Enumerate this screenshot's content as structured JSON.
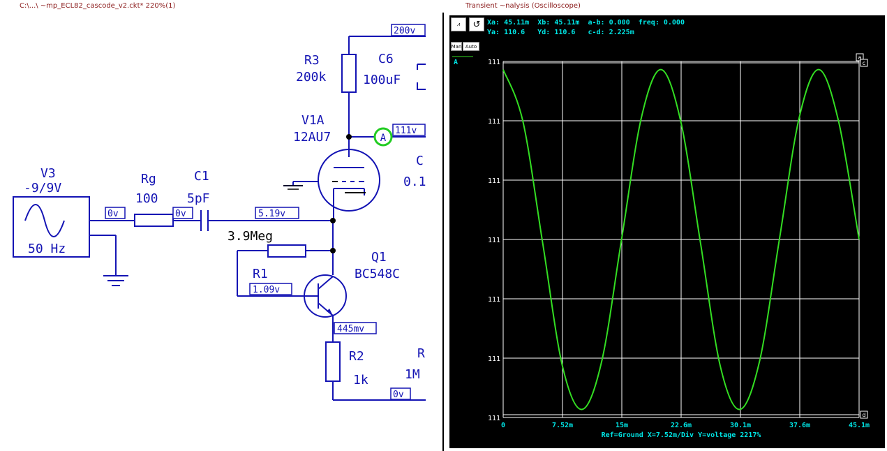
{
  "schematic_title": "C:\\...\\ ~mp_ECL82_cascode_v2.ckt* 220%(1)",
  "scope_title": "Transient ~nalysis (Oscilloscope)",
  "components": {
    "v3_name": "V3",
    "v3_value": "-9/9V",
    "v3_freq": "50 Hz",
    "rg_name": "Rg",
    "rg_value": "100",
    "c1_name": "C1",
    "c1_value": "5pF",
    "r3_name": "R3",
    "r3_value": "200k",
    "c6_name": "C6",
    "c6_value": "100uF",
    "v1a_name": "V1A",
    "v1a_value": "12AU7",
    "c_partial": "C",
    "c_partial_value": "0.1",
    "rbias_value": "3.9Meg",
    "r1_name": "R1",
    "q1_name": "Q1",
    "q1_value": "BC548C",
    "r2_name": "R2",
    "r2_value": "1k",
    "r_partial": "R",
    "r_partial_value": "1M"
  },
  "node_labels": {
    "supply": "200v",
    "plate": "111v",
    "grid": "5.19v",
    "source_out": "0v",
    "rg_out": "0v",
    "base": "1.09v",
    "emitter": "445mv",
    "bottom": "0v"
  },
  "probe_label": "A",
  "scope": {
    "readout_line1": "Xa: 45.11m  Xb: 45.11m  a-b: 0.000  freq: 0.000",
    "readout_line2": "Ya: 110.6   Yd: 110.6   c-d: 2.225m",
    "toolbar": {
      "man": "Man",
      "auto": "Auto"
    },
    "trace_label": "A",
    "cursor_labels": [
      "a",
      "c",
      "d"
    ],
    "y_ticks": [
      "111",
      "111",
      "111",
      "111",
      "111",
      "111",
      "111"
    ],
    "x_ticks": [
      "0",
      "7.52m",
      "15m",
      "22.6m",
      "30.1m",
      "37.6m",
      "45.1m"
    ],
    "footer": "Ref=Ground  X=7.52m/Div Y=voltage 2217%",
    "colors": {
      "trace": "#33dd22",
      "text": "#00e5e5",
      "grid": "#ffffff",
      "background": "#000000"
    }
  },
  "chart_data": {
    "type": "line",
    "title": "",
    "xlabel": "",
    "ylabel": "",
    "xlim": [
      0,
      0.0451
    ],
    "ylim": [
      110.6,
      110.6022
    ],
    "series": [
      {
        "x": [
          0,
          0.0025,
          0.005,
          0.0075,
          0.01,
          0.0125,
          0.015,
          0.0175,
          0.02,
          0.0225,
          0.025,
          0.0275,
          0.03,
          0.0325,
          0.035,
          0.0375,
          0.04,
          0.0425,
          0.0451
        ],
        "y": [
          110.60215,
          110.60183,
          110.60108,
          110.60032,
          110.60005,
          110.60035,
          110.6011,
          110.60185,
          110.60215,
          110.60183,
          110.60108,
          110.60032,
          110.60005,
          110.60035,
          110.6011,
          110.60185,
          110.60215,
          110.60183,
          110.6011
        ]
      }
    ]
  }
}
